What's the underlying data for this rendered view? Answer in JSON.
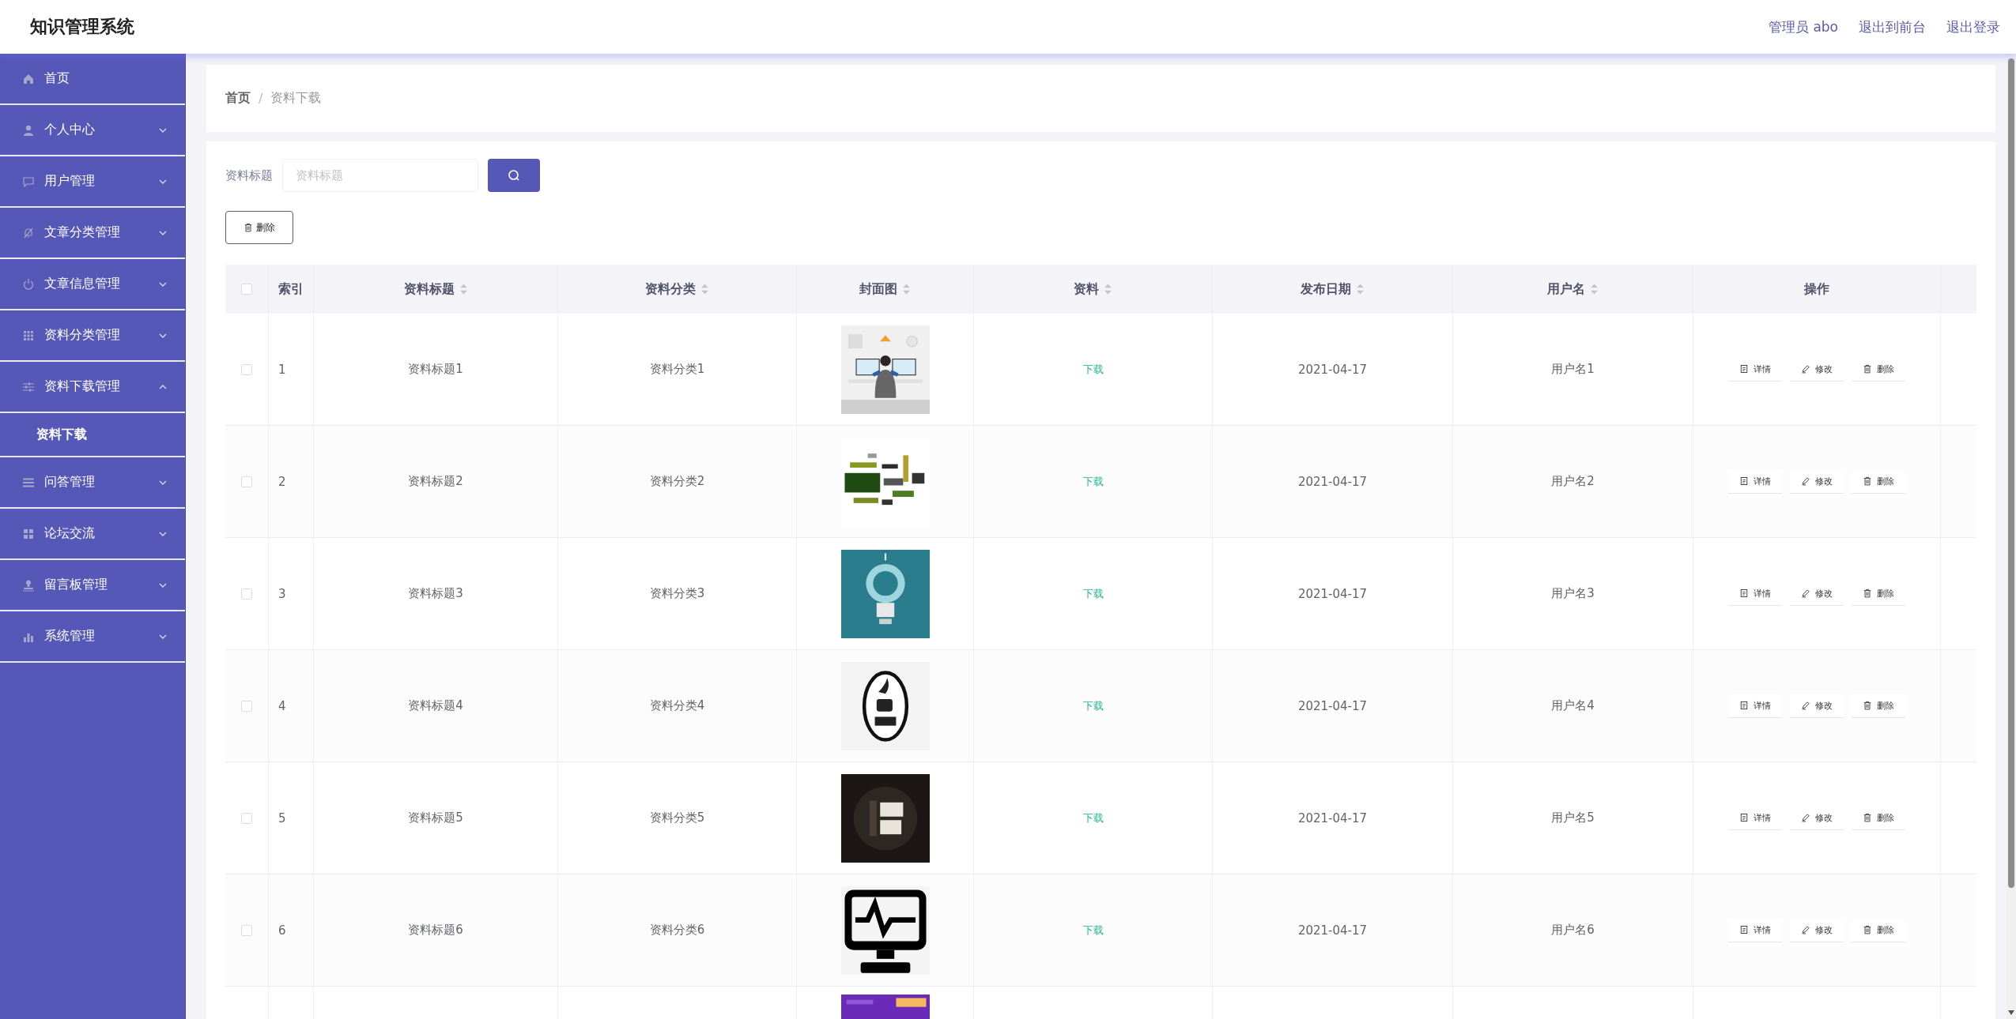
{
  "header": {
    "title": "知识管理系统",
    "links": [
      "管理员 abo",
      "退出到前台",
      "退出登录"
    ]
  },
  "menu": [
    {
      "label": "首页",
      "kind": "link"
    },
    {
      "label": "个人中心",
      "kind": "submenu",
      "expanded": false
    },
    {
      "label": "用户管理",
      "kind": "submenu",
      "expanded": false
    },
    {
      "label": "文章分类管理",
      "kind": "submenu",
      "expanded": false
    },
    {
      "label": "文章信息管理",
      "kind": "submenu",
      "expanded": false
    },
    {
      "label": "资料分类管理",
      "kind": "submenu",
      "expanded": false
    },
    {
      "label": "资料下载管理",
      "kind": "submenu",
      "expanded": true,
      "children": [
        {
          "label": "资料下载",
          "selected": true
        }
      ]
    },
    {
      "label": "问答管理",
      "kind": "submenu",
      "expanded": false
    },
    {
      "label": "论坛交流",
      "kind": "submenu",
      "expanded": false
    },
    {
      "label": "留言板管理",
      "kind": "submenu",
      "expanded": false
    },
    {
      "label": "系统管理",
      "kind": "submenu",
      "expanded": false
    }
  ],
  "breadcrumb": {
    "items": [
      "首页",
      "资料下载"
    ],
    "separator": "/"
  },
  "search": {
    "label": "资料标题",
    "placeholder": "资料标题"
  },
  "delete_button": "删除",
  "table": {
    "select_all_checked": false,
    "columns": [
      {
        "label": "索引",
        "sortable": false
      },
      {
        "label": "资料标题",
        "sortable": true
      },
      {
        "label": "资料分类",
        "sortable": true
      },
      {
        "label": "封面图",
        "sortable": true
      },
      {
        "label": "资料",
        "sortable": true
      },
      {
        "label": "发布日期",
        "sortable": true
      },
      {
        "label": "用户名",
        "sortable": true
      },
      {
        "label": "操作",
        "sortable": false
      }
    ],
    "rows": [
      {
        "checked": false,
        "index": "1",
        "title": "资料标题1",
        "category": "资料分类1",
        "cover": {
          "kind": "picture"
        },
        "file": "下载",
        "date": "2021-04-17",
        "user": "用户名1",
        "actions": [
          "详情",
          "修改",
          "删除"
        ]
      },
      {
        "checked": false,
        "index": "2",
        "title": "资料标题2",
        "category": "资料分类2",
        "cover": {
          "kind": "picture"
        },
        "file": "下载",
        "date": "2021-04-17",
        "user": "用户名2",
        "actions": [
          "详情",
          "修改",
          "删除"
        ]
      },
      {
        "checked": false,
        "index": "3",
        "title": "资料标题3",
        "category": "资料分类3",
        "cover": {
          "kind": "picture"
        },
        "file": "下载",
        "date": "2021-04-17",
        "user": "用户名3",
        "actions": [
          "详情",
          "修改",
          "删除"
        ]
      },
      {
        "checked": false,
        "index": "4",
        "title": "资料标题4",
        "category": "资料分类4",
        "cover": {
          "kind": "picture"
        },
        "file": "下载",
        "date": "2021-04-17",
        "user": "用户名4",
        "actions": [
          "详情",
          "修改",
          "删除"
        ]
      },
      {
        "checked": false,
        "index": "5",
        "title": "资料标题5",
        "category": "资料分类5",
        "cover": {
          "kind": "picture"
        },
        "file": "下载",
        "date": "2021-04-17",
        "user": "用户名5",
        "actions": [
          "详情",
          "修改",
          "删除"
        ]
      },
      {
        "checked": false,
        "index": "6",
        "title": "资料标题6",
        "category": "资料分类6",
        "cover": {
          "kind": "picture"
        },
        "file": "下载",
        "date": "2021-04-17",
        "user": "用户名6",
        "actions": [
          "详情",
          "修改",
          "删除"
        ]
      },
      {
        "cover": {
          "kind": "picture"
        }
      }
    ]
  }
}
